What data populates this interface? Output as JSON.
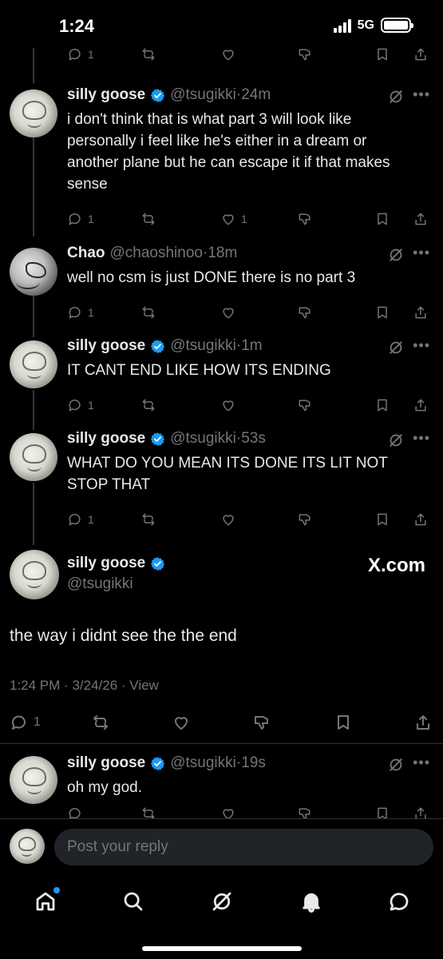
{
  "status_bar": {
    "time": "1:24",
    "network": "5G"
  },
  "thread": [
    {
      "name": "silly goose",
      "handle": "@tsugikki",
      "time": "24m",
      "verified": true,
      "text": "i don't think that is what part 3 will look like personally i feel like he's either in a dream or another plane  but he can escape it if that makes sense",
      "replies": "1",
      "likes": "1"
    },
    {
      "name": "Chao",
      "handle": "@chaoshinoo",
      "time": "18m",
      "verified": false,
      "text": "well no csm is just DONE there is no part 3",
      "replies": "1",
      "likes": ""
    },
    {
      "name": "silly goose",
      "handle": "@tsugikki",
      "time": "1m",
      "verified": true,
      "text": "IT CANT END LIKE HOW ITS ENDING",
      "replies": "1",
      "likes": ""
    },
    {
      "name": "silly goose",
      "handle": "@tsugikki",
      "time": "53s",
      "verified": true,
      "text": "WHAT DO YOU MEAN ITS DONE ITS LIT NOT STOP THAT",
      "replies": "1",
      "likes": ""
    }
  ],
  "top_partial": {
    "replies": "1"
  },
  "main_tweet": {
    "name": "silly goose",
    "handle": "@tsugikki",
    "watermark": "X.com",
    "text": "the way i didnt see the the end",
    "time": "1:24 PM",
    "date": "3/24/26",
    "view_label": "View",
    "replies": "1"
  },
  "reply": {
    "name": "silly goose",
    "handle": "@tsugikki",
    "time": "19s",
    "text": "oh my god."
  },
  "composer": {
    "placeholder": "Post your reply"
  },
  "nav": [
    "home-icon",
    "search-icon",
    "grok-icon",
    "notifications-icon",
    "messages-icon"
  ],
  "colors": {
    "background": "#000000",
    "accent": "#1d9bf0",
    "muted": "#71767b",
    "text": "#e7e9ea"
  }
}
